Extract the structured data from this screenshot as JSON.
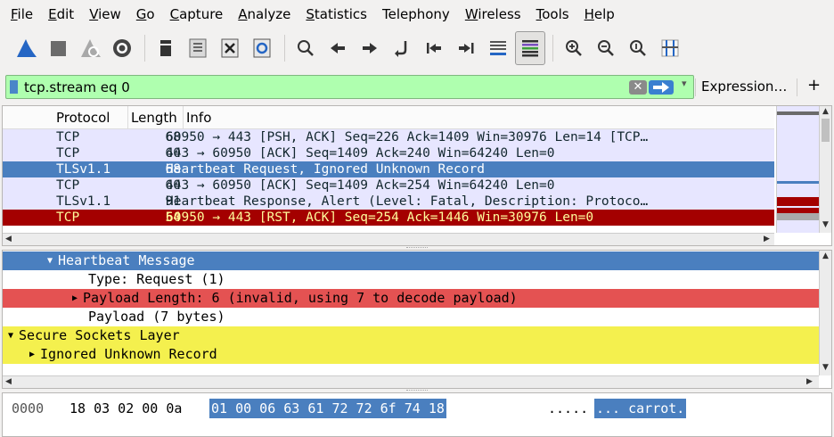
{
  "menubar": {
    "items": [
      {
        "mnemonic": "F",
        "rest": "ile"
      },
      {
        "mnemonic": "E",
        "rest": "dit"
      },
      {
        "mnemonic": "V",
        "rest": "iew"
      },
      {
        "mnemonic": "G",
        "rest": "o"
      },
      {
        "mnemonic": "C",
        "rest": "apture"
      },
      {
        "mnemonic": "A",
        "rest": "nalyze"
      },
      {
        "mnemonic": "S",
        "rest": "tatistics"
      },
      {
        "mnemonic": "",
        "rest": "Telephony"
      },
      {
        "mnemonic": "W",
        "rest": "ireless"
      },
      {
        "mnemonic": "T",
        "rest": "ools"
      },
      {
        "mnemonic": "H",
        "rest": "elp"
      }
    ]
  },
  "toolbar": {
    "icons": [
      "shark-fin-start-icon",
      "stop-square-icon",
      "restart-fin-icon",
      "capture-options-gear-icon",
      "open-file-icon",
      "save-file-icon",
      "close-file-icon",
      "reload-file-icon",
      "find-packet-icon",
      "go-back-icon",
      "go-forward-icon",
      "go-to-packet-icon",
      "first-packet-icon",
      "last-packet-icon",
      "autoscroll-icon",
      "colorize-icon",
      "zoom-in-icon",
      "zoom-out-icon",
      "normal-size-icon",
      "resize-columns-icon"
    ]
  },
  "filter": {
    "value": "tcp.stream eq 0",
    "expression_label": "Expression…",
    "plus_label": "+",
    "clear_glyph": "✕"
  },
  "packet_list": {
    "headers": {
      "protocol": "Protocol",
      "length": "Length",
      "info": "Info"
    },
    "rows": [
      {
        "protocol": "TCP",
        "length": "68",
        "info": "60950 → 443 [PSH, ACK] Seq=226 Ack=1409 Win=30976 Len=14 [TCP…",
        "style": "light"
      },
      {
        "protocol": "TCP",
        "length": "60",
        "info": "443 → 60950 [ACK] Seq=1409 Ack=240 Win=64240 Len=0",
        "style": "light"
      },
      {
        "protocol": "TLSv1.1",
        "length": "68",
        "info": "Heartbeat Request, Ignored Unknown Record",
        "style": "selected"
      },
      {
        "protocol": "TCP",
        "length": "60",
        "info": "443 → 60950 [ACK] Seq=1409 Ack=254 Win=64240 Len=0",
        "style": "light"
      },
      {
        "protocol": "TLSv1.1",
        "length": "91",
        "info": "Heartbeat Response, Alert (Level: Fatal, Description: Protoco…",
        "style": "light"
      },
      {
        "protocol": "TCP",
        "length": "54",
        "info": "60950 → 443 [RST, ACK] Seq=254 Ack=1446 Win=30976 Len=0",
        "style": "dark"
      }
    ]
  },
  "details": {
    "rows": [
      {
        "indent": 50,
        "toggle": "down",
        "text": "Heartbeat Message",
        "style": "blue"
      },
      {
        "indent": 96,
        "toggle": "",
        "text": "Type: Request (1)",
        "style": "plain"
      },
      {
        "indent": 78,
        "toggle": "right",
        "text": "Payload Length: 6 (invalid, using 7 to decode payload)",
        "style": "red"
      },
      {
        "indent": 96,
        "toggle": "",
        "text": "Payload (7 bytes)",
        "style": "plain"
      },
      {
        "indent": 6,
        "toggle": "down",
        "text": "Secure Sockets Layer",
        "style": "yellow"
      },
      {
        "indent": 30,
        "toggle": "right",
        "text": "Ignored Unknown Record",
        "style": "yellow"
      }
    ]
  },
  "bytes": {
    "offset": "0000",
    "hex_plain": "18 03 02 00 0a",
    "hex_selected": "01 00 06  63 61 72 72 6f 74 18",
    "ascii_plain": ".....",
    "ascii_selected": "... carrot."
  },
  "colors": {
    "selected": "#4a7fbf",
    "tcp_row": "#e7e6ff",
    "rst_row": "#a40000",
    "error_field": "#e45252",
    "ssl_field": "#f4f04e",
    "filter_valid": "#afffaf"
  }
}
